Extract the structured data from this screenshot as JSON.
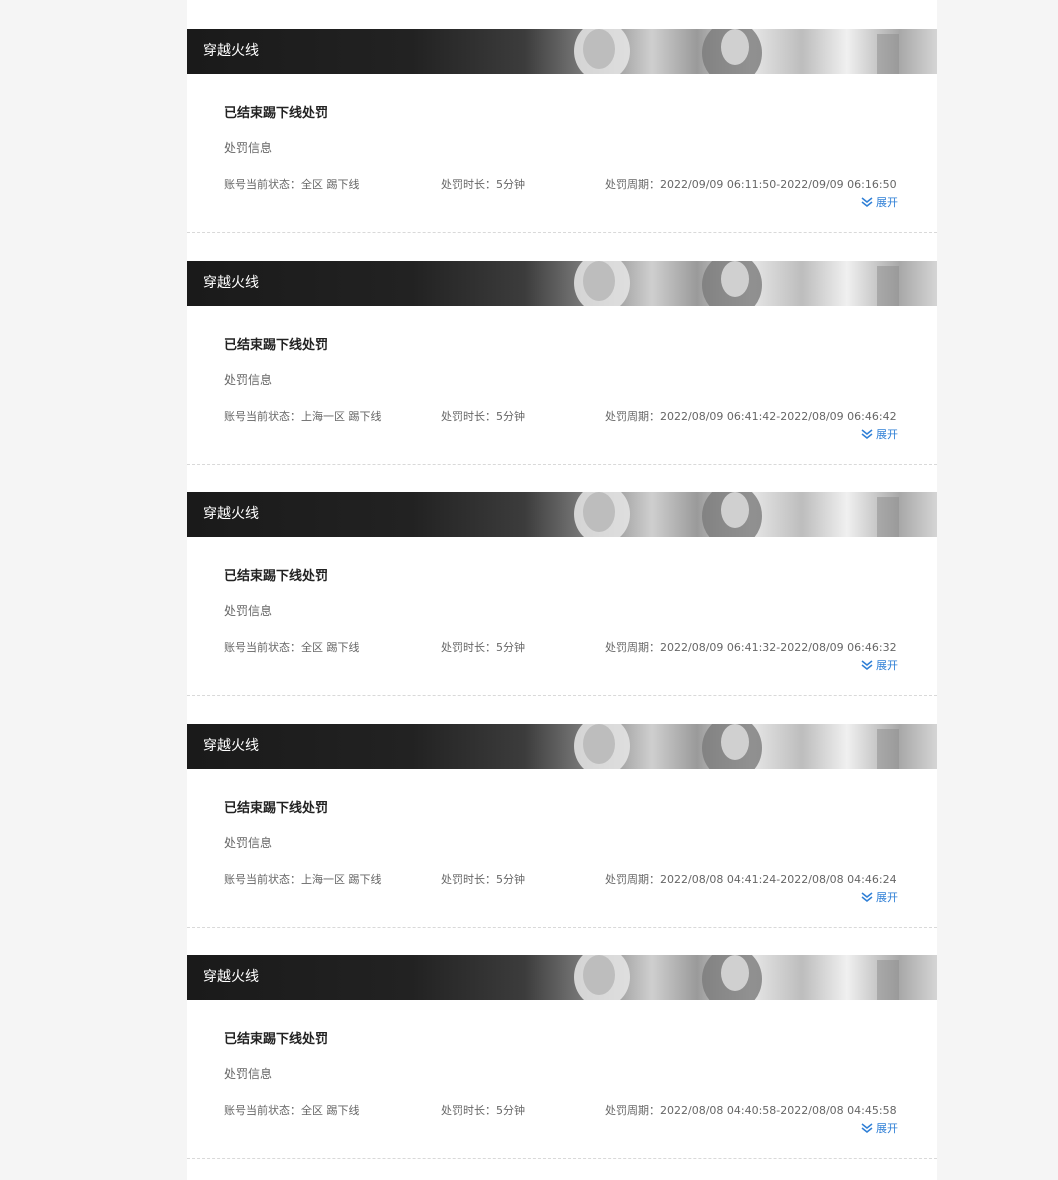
{
  "records": [
    {
      "game": "穿越火线",
      "title": "已结束踢下线处罚",
      "info_heading": "处罚信息",
      "status_label": "账号当前状态：",
      "status_value": "全区 踢下线",
      "duration_label": "处罚时长：",
      "duration_value": "5分钟",
      "period_label": "处罚周期：",
      "period_value": "2022/09/09 06:11:50-2022/09/09 06:16:50",
      "expand_label": "展开"
    },
    {
      "game": "穿越火线",
      "title": "已结束踢下线处罚",
      "info_heading": "处罚信息",
      "status_label": "账号当前状态：",
      "status_value": "上海一区 踢下线",
      "duration_label": "处罚时长：",
      "duration_value": "5分钟",
      "period_label": "处罚周期：",
      "period_value": "2022/08/09 06:41:42-2022/08/09 06:46:42",
      "expand_label": "展开"
    },
    {
      "game": "穿越火线",
      "title": "已结束踢下线处罚",
      "info_heading": "处罚信息",
      "status_label": "账号当前状态：",
      "status_value": "全区 踢下线",
      "duration_label": "处罚时长：",
      "duration_value": "5分钟",
      "period_label": "处罚周期：",
      "period_value": "2022/08/09 06:41:32-2022/08/09 06:46:32",
      "expand_label": "展开"
    },
    {
      "game": "穿越火线",
      "title": "已结束踢下线处罚",
      "info_heading": "处罚信息",
      "status_label": "账号当前状态：",
      "status_value": "上海一区 踢下线",
      "duration_label": "处罚时长：",
      "duration_value": "5分钟",
      "period_label": "处罚周期：",
      "period_value": "2022/08/08 04:41:24-2022/08/08 04:46:24",
      "expand_label": "展开"
    },
    {
      "game": "穿越火线",
      "title": "已结束踢下线处罚",
      "info_heading": "处罚信息",
      "status_label": "账号当前状态：",
      "status_value": "全区 踢下线",
      "duration_label": "处罚时长：",
      "duration_value": "5分钟",
      "period_label": "处罚周期：",
      "period_value": "2022/08/08 04:40:58-2022/08/08 04:45:58",
      "expand_label": "展开"
    }
  ],
  "colors": {
    "link": "#2f7fd6",
    "page_bg": "#f5f5f5",
    "card_bg": "#ffffff"
  },
  "icons": {
    "expand": "double-chevron-down-icon"
  }
}
